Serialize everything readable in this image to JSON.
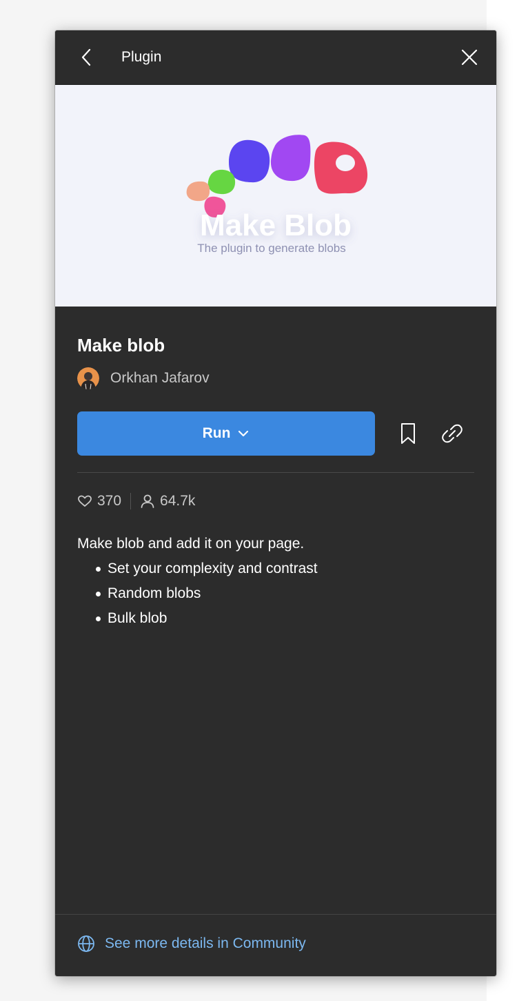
{
  "header": {
    "title": "Plugin"
  },
  "banner": {
    "title": "Make Blob",
    "subtitle": "The plugin to generate blobs"
  },
  "plugin": {
    "name": "Make blob",
    "author": "Orkhan Jafarov"
  },
  "actions": {
    "run_label": "Run"
  },
  "stats": {
    "likes": "370",
    "users": "64.7k"
  },
  "description": {
    "intro": "Make blob and add it on your page.",
    "bullets": [
      "Set your complexity and contrast",
      "Random blobs",
      "Bulk blob"
    ]
  },
  "footer": {
    "link_text": "See more details in Community"
  },
  "icons": {
    "back": "chevron-left-icon",
    "close": "close-icon",
    "run_dropdown": "chevron-down-icon",
    "bookmark": "bookmark-icon",
    "link": "link-icon",
    "likes": "heart-icon",
    "users": "user-icon",
    "community": "globe-icon"
  },
  "colors": {
    "panel_bg": "#2c2c2c",
    "run_button": "#3b88e0",
    "link_text": "#7cb8f0",
    "banner_bg": "#f2f3fa",
    "blob_indigo": "#5b45f0",
    "blob_purple": "#a148f2",
    "blob_red": "#ec4564",
    "blob_green": "#66d642",
    "blob_peach": "#f2a688",
    "blob_pink": "#f0559a"
  }
}
